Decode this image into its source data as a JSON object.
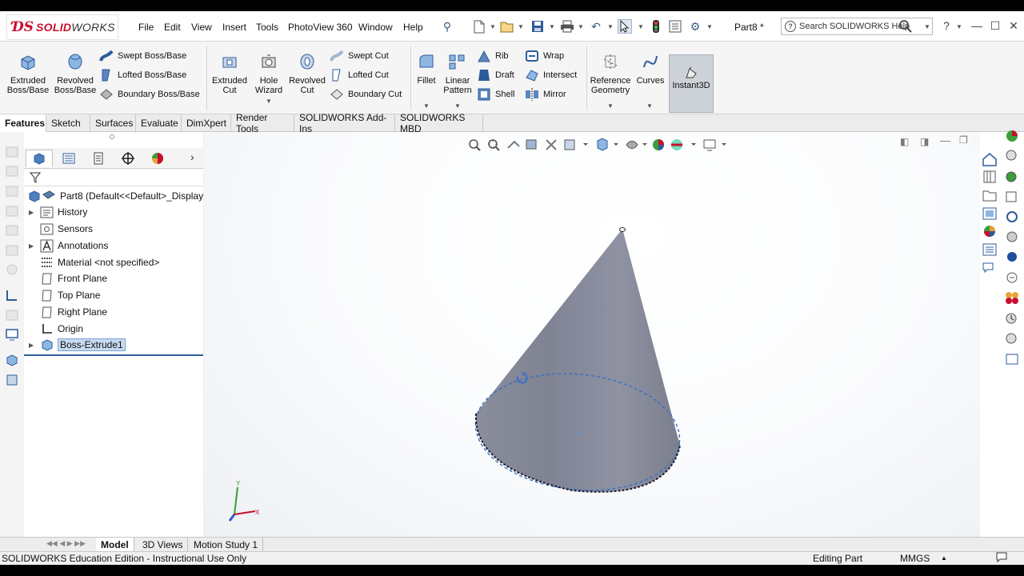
{
  "app": {
    "brand_ds": "ƊS",
    "brand_solid": "SOLID",
    "brand_works": "WORKS",
    "document_title": "Part8 *",
    "accent": "#c8102e"
  },
  "menu": [
    "File",
    "Edit",
    "View",
    "Insert",
    "Tools",
    "PhotoView 360",
    "Window",
    "Help"
  ],
  "search": {
    "placeholder": "Search SOLIDWORKS Help"
  },
  "ribbon": {
    "extruded_boss": "Extruded Boss/Base",
    "revolved_boss": "Revolved Boss/Base",
    "swept_boss": "Swept Boss/Base",
    "lofted_boss": "Lofted Boss/Base",
    "boundary_boss": "Boundary Boss/Base",
    "extruded_cut": "Extruded Cut",
    "hole_wizard": "Hole Wizard",
    "revolved_cut": "Revolved Cut",
    "swept_cut": "Swept Cut",
    "lofted_cut": "Lofted Cut",
    "boundary_cut": "Boundary Cut",
    "fillet": "Fillet",
    "linear_pattern": "Linear Pattern",
    "rib": "Rib",
    "draft": "Draft",
    "shell": "Shell",
    "wrap": "Wrap",
    "intersect": "Intersect",
    "mirror": "Mirror",
    "reference_geometry": "Reference Geometry",
    "curves": "Curves",
    "instant3d": "Instant3D"
  },
  "tabs": [
    "Features",
    "Sketch",
    "Surfaces",
    "Evaluate",
    "DimXpert",
    "Render Tools",
    "SOLIDWORKS Add-Ins",
    "SOLIDWORKS MBD"
  ],
  "tree": {
    "root": "Part8  (Default<<Default>_Display S",
    "items": [
      "History",
      "Sensors",
      "Annotations",
      "Material <not specified>",
      "Front Plane",
      "Top Plane",
      "Right Plane",
      "Origin",
      "Boss-Extrude1"
    ]
  },
  "bottom_tabs": [
    "Model",
    "3D Views",
    "Motion Study 1"
  ],
  "status": {
    "left": "SOLIDWORKS Education Edition - Instructional Use Only",
    "editing": "Editing Part",
    "units": "MMGS"
  },
  "triad": {
    "x": "X",
    "y": "Y"
  }
}
